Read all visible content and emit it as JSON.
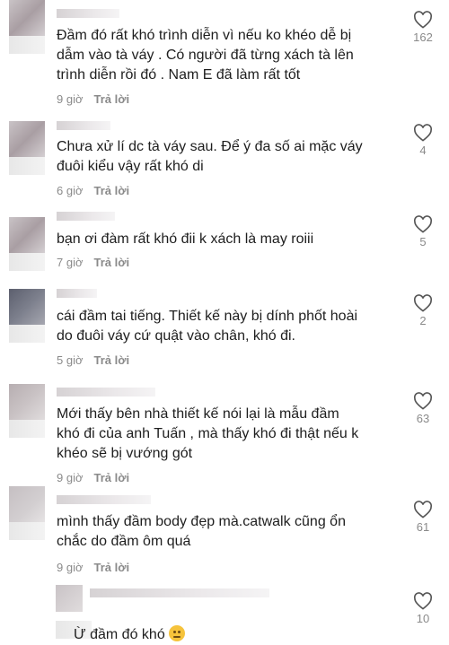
{
  "comments": [
    {
      "text": "Đầm đó rất khó trình diễn vì nếu ko khéo dễ bị\ndẫm vào tà váy . Có người đã từng xách tà lên\ntrình diễn rồi đó . Nam E đã làm rất tốt",
      "time": "9 giờ",
      "reply": "Trả lời",
      "likes": "162"
    },
    {
      "text": "Chưa xử lí dc tà váy sau. Để ý đa số ai mặc váy\nđuôi kiểu vậy rất khó di",
      "time": "6 giờ",
      "reply": "Trả lời",
      "likes": "4"
    },
    {
      "text": "bạn ơi đàm rất khó đii k xách là may roiii",
      "time": "7 giờ",
      "reply": "Trả lời",
      "likes": "5"
    },
    {
      "text": "cái đầm tai tiếng. Thiết kế này bị dính phốt hoài\ndo đuôi váy cứ quật vào chân, khó đi.",
      "time": "5 giờ",
      "reply": "Trả lời",
      "likes": "2"
    },
    {
      "text": "Mới thấy bên nhà thiết kế nói lại là mẫu đầm\nkhó đi của anh Tuấn , mà thấy khó đi thật nếu k\nkhéo sẽ bị vướng gót",
      "time": "9 giờ",
      "reply": "Trả lời",
      "likes": "63"
    },
    {
      "text": "mình thấy đầm body đẹp mà.catwalk cũng ổn\nchắc do đầm ôm quá",
      "time": "9 giờ",
      "reply": "Trả lời",
      "likes": "61"
    }
  ],
  "reply_comment": {
    "text": "Ừ đầm đó khó",
    "emoji": "sad-face-emoji",
    "likes": "10"
  },
  "colors": {
    "heart": "#555555",
    "text": "#1e1e1e",
    "meta": "#8a8a8a"
  }
}
